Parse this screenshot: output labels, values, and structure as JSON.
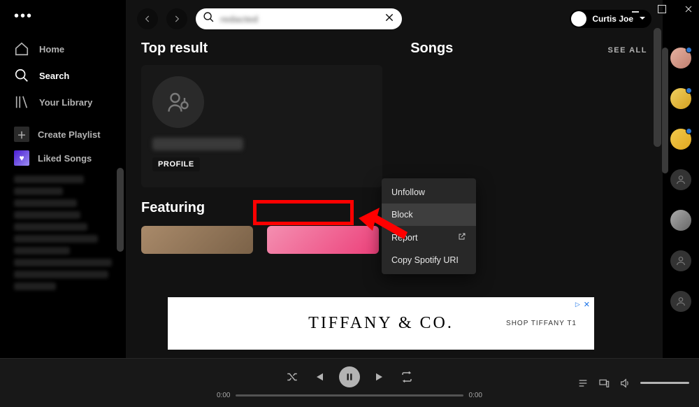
{
  "window": {
    "user_name": "Curtis Joe"
  },
  "sidebar": {
    "nav": [
      {
        "label": "Home"
      },
      {
        "label": "Search"
      },
      {
        "label": "Your Library"
      }
    ],
    "playlist_actions": [
      {
        "label": "Create Playlist"
      },
      {
        "label": "Liked Songs"
      }
    ]
  },
  "search": {
    "value": "redacted",
    "clear_label": "Clear"
  },
  "headings": {
    "top_result": "Top result",
    "songs": "Songs",
    "see_all": "SEE ALL",
    "featuring": "Featuring"
  },
  "top_result": {
    "name_redacted": "redacted profile",
    "badge": "PROFILE"
  },
  "context_menu": {
    "items": [
      {
        "label": "Unfollow"
      },
      {
        "label": "Block"
      },
      {
        "label": "Report"
      },
      {
        "label": "Copy Spotify URI"
      }
    ],
    "highlighted_index": 1
  },
  "ad": {
    "title": "TIFFANY & CO.",
    "cta": "SHOP TIFFANY T1",
    "adchoices": "▷"
  },
  "player": {
    "elapsed": "0:00",
    "total": "0:00"
  }
}
